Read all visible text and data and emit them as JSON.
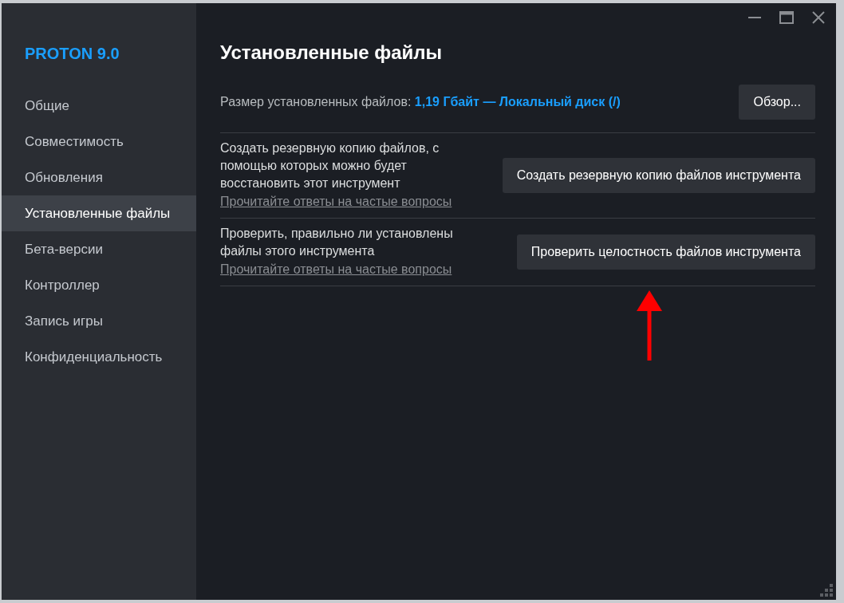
{
  "sidebar": {
    "title": "PROTON 9.0",
    "items": [
      {
        "label": "Общие",
        "selected": false
      },
      {
        "label": "Совместимость",
        "selected": false
      },
      {
        "label": "Обновления",
        "selected": false
      },
      {
        "label": "Установленные файлы",
        "selected": true
      },
      {
        "label": "Бета-версии",
        "selected": false
      },
      {
        "label": "Контроллер",
        "selected": false
      },
      {
        "label": "Запись игры",
        "selected": false
      },
      {
        "label": "Конфиденциальность",
        "selected": false
      }
    ]
  },
  "main": {
    "title": "Установленные файлы",
    "size": {
      "label": "Размер установленных файлов:",
      "value": "1,19 Гбайт — Локальный диск (/)",
      "button": "Обзор..."
    },
    "sections": [
      {
        "text": "Создать резервную копию файлов, с помощью которых можно будет восстановить этот инструмент",
        "link": "Прочитайте ответы на частые вопросы",
        "button": "Создать резервную копию файлов инструмента"
      },
      {
        "text": "Проверить, правильно ли установлены файлы этого инструмента",
        "link": "Прочитайте ответы на частые вопросы",
        "button": "Проверить целостность файлов инструмента"
      }
    ]
  }
}
